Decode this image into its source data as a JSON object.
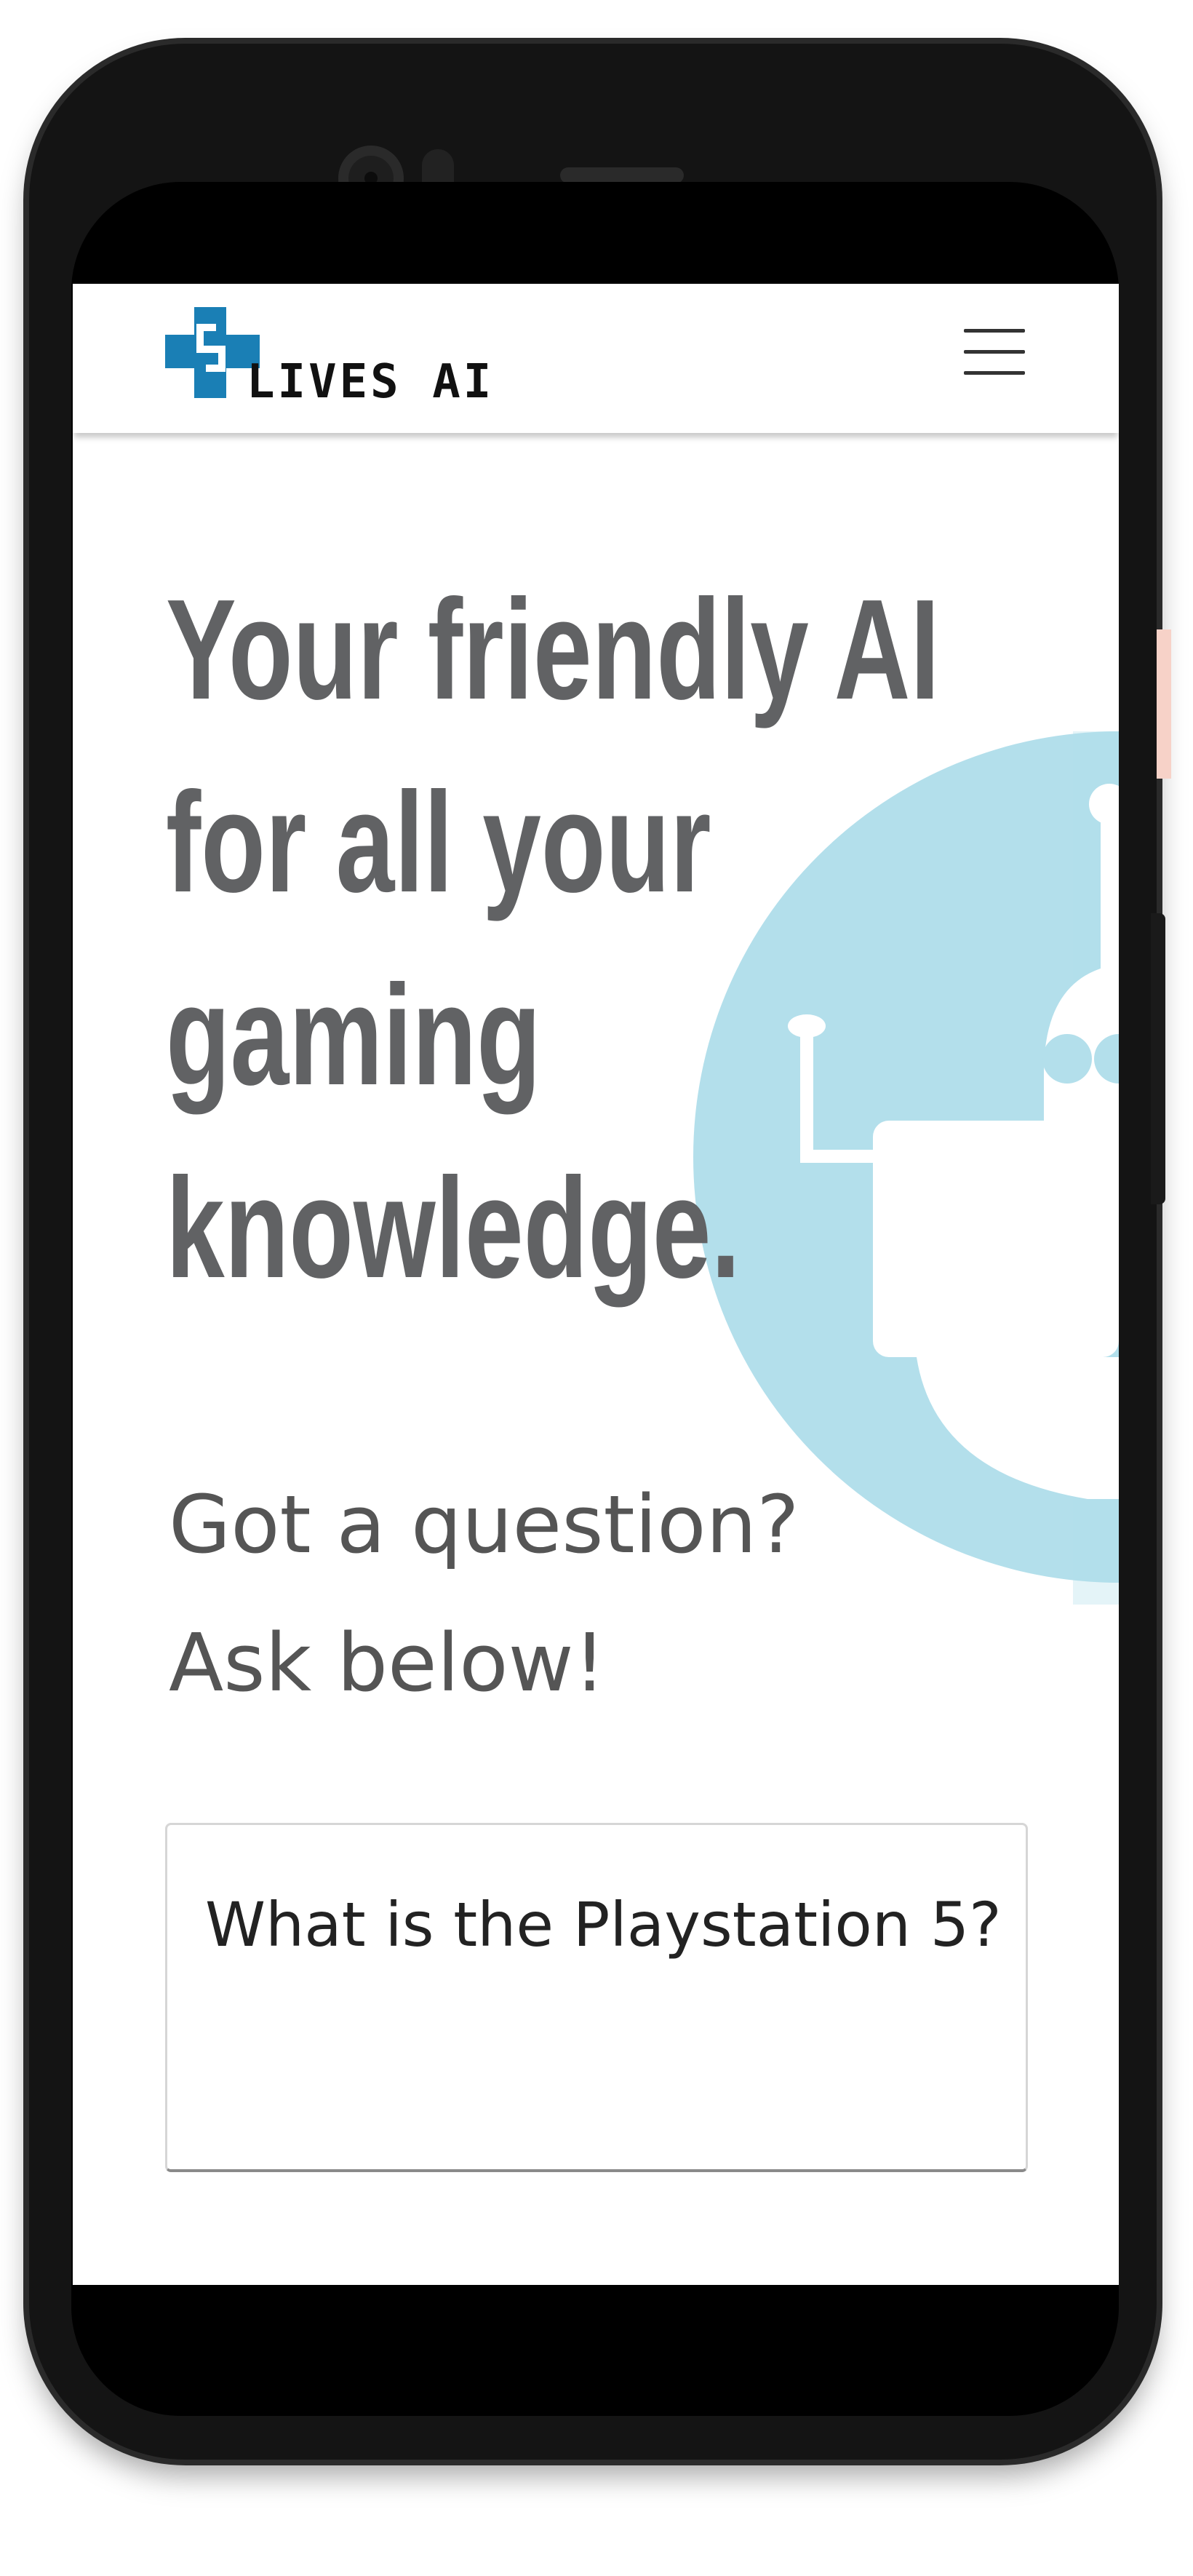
{
  "app": {
    "brand_name": "LIVES AI"
  },
  "hero": {
    "title_lines": [
      "Your friendly AI",
      "for all your",
      "gaming",
      "knowledge."
    ]
  },
  "prompt": {
    "line1": "Got a question?",
    "line2": "Ask below!"
  },
  "question_input": {
    "value": "What is the Playstation 5?"
  },
  "icons": {
    "logo": "plus-cross-logo-icon",
    "menu": "hamburger-menu-icon",
    "background": "robot-illustration-icon"
  },
  "colors": {
    "logo_blue": "#1a7fb5",
    "robot_bg": "#b3dfeb",
    "title_gray": "#616264",
    "phone_frame": "#141414"
  }
}
